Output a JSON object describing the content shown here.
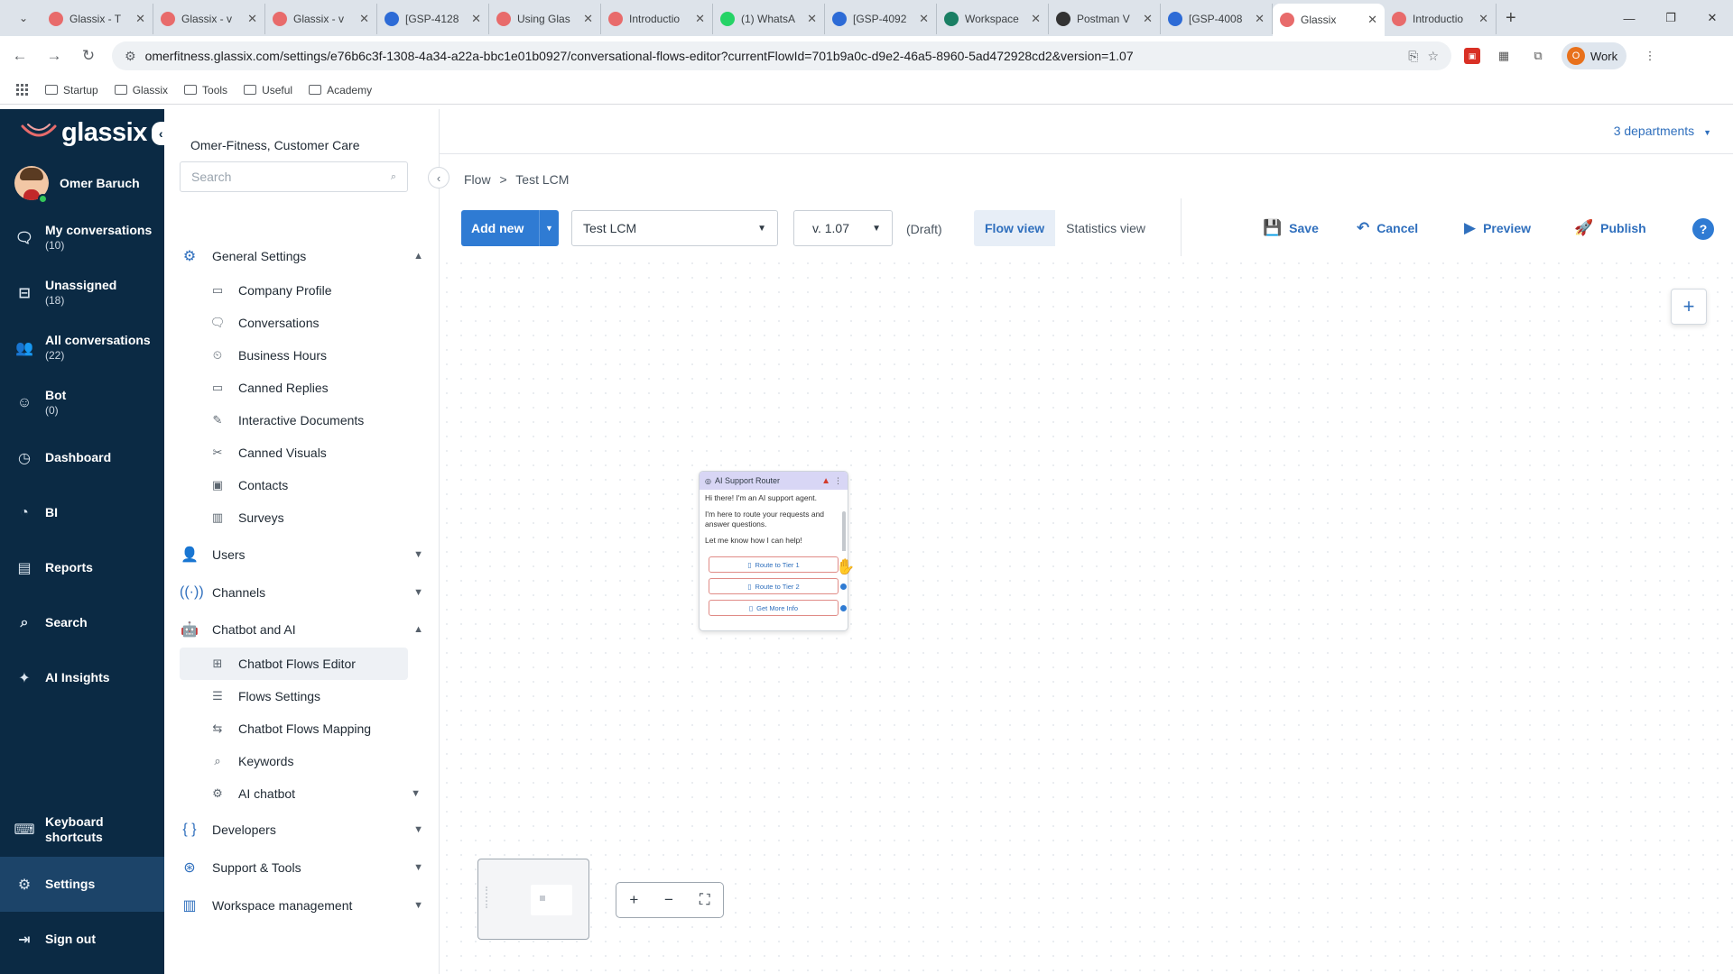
{
  "browser": {
    "tabs": [
      {
        "title": "Glassix - T",
        "fav": "glassix-icon",
        "color": "#e86b6b"
      },
      {
        "title": "Glassix - v",
        "fav": "glassix-icon",
        "color": "#e86b6b"
      },
      {
        "title": "Glassix - v",
        "fav": "glassix-icon",
        "color": "#e86b6b"
      },
      {
        "title": "[GSP-4128",
        "fav": "jira-icon",
        "color": "#2d6bd6"
      },
      {
        "title": "Using Glas",
        "fav": "glassix-icon",
        "color": "#e86b6b"
      },
      {
        "title": "Introductio",
        "fav": "glassix-icon",
        "color": "#e86b6b"
      },
      {
        "title": "(1) WhatsA",
        "fav": "whatsapp-icon",
        "color": "#25d366"
      },
      {
        "title": "[GSP-4092",
        "fav": "jira-icon",
        "color": "#2d6bd6"
      },
      {
        "title": "Workspace",
        "fav": "chatgpt-icon",
        "color": "#1a7f64"
      },
      {
        "title": "Postman V",
        "fav": "postman-icon",
        "color": "#333333"
      },
      {
        "title": "[GSP-4008",
        "fav": "jira-icon",
        "color": "#2d6bd6"
      },
      {
        "title": "Glassix",
        "fav": "glassix-icon",
        "color": "#e86b6b",
        "active": true
      },
      {
        "title": "Introductio",
        "fav": "glassix-icon",
        "color": "#e86b6b"
      }
    ],
    "url": "omerfitness.glassix.com/settings/e76b6c3f-1308-4a34-a22a-bbc1e01b0927/conversational-flows-editor?currentFlowId=701b9a0c-d9e2-46a5-8960-5ad472928cd2&version=1.07",
    "profile_initial": "O",
    "profile_label": "Work",
    "bookmarks": [
      "Startup",
      "Glassix",
      "Tools",
      "Useful",
      "Academy"
    ]
  },
  "app": {
    "logo_text": "glassix",
    "user_name": "Omer Baruch",
    "nav": [
      {
        "label": "My conversations",
        "count": "(10)",
        "icon": "chat-bubbles-icon"
      },
      {
        "label": "Unassigned",
        "count": "(18)",
        "icon": "inbox-icon"
      },
      {
        "label": "All conversations",
        "count": "(22)",
        "icon": "team-icon"
      },
      {
        "label": "Bot",
        "count": "(0)",
        "icon": "bot-icon"
      },
      {
        "label": "Dashboard",
        "count": "",
        "icon": "dashboard-icon"
      },
      {
        "label": "BI",
        "count": "",
        "icon": "pie-chart-icon"
      },
      {
        "label": "Reports",
        "count": "",
        "icon": "report-icon"
      },
      {
        "label": "Search",
        "count": "",
        "icon": "search-icon"
      },
      {
        "label": "AI Insights",
        "count": "",
        "icon": "sparkle-icon"
      }
    ],
    "nav_bottom": [
      {
        "label": "Keyboard shortcuts",
        "icon": "keyboard-icon"
      },
      {
        "label": "Settings",
        "icon": "gear-icon"
      },
      {
        "label": "Sign out",
        "icon": "sign-out-icon"
      }
    ],
    "departments_label": "3 departments"
  },
  "settings": {
    "department": "Omer-Fitness, Customer Care",
    "search_placeholder": "Search",
    "general": {
      "label": "General Settings",
      "items": [
        "Company Profile",
        "Conversations",
        "Business Hours",
        "Canned Replies",
        "Interactive Documents",
        "Canned Visuals",
        "Contacts",
        "Surveys"
      ]
    },
    "users": "Users",
    "channels": "Channels",
    "chatbot": {
      "label": "Chatbot and AI",
      "items": [
        "Chatbot Flows Editor",
        "Flows Settings",
        "Chatbot Flows Mapping",
        "Keywords",
        "AI chatbot"
      ]
    },
    "developers": "Developers",
    "support": "Support & Tools",
    "workspace": "Workspace management"
  },
  "editor": {
    "breadcrumb_root": "Flow",
    "breadcrumb_sep": ">",
    "breadcrumb_current": "Test LCM",
    "add_new": "Add new",
    "flow_name": "Test LCM",
    "version": "v. 1.07",
    "status": "(Draft)",
    "flow_view": "Flow view",
    "stats_view": "Statistics view",
    "save": "Save",
    "cancel": "Cancel",
    "preview": "Preview",
    "publish": "Publish",
    "help": "?"
  },
  "node": {
    "title": "AI Support Router",
    "lines": [
      "Hi there! I'm an AI support agent.",
      "I'm here to route your requests and answer questions.",
      "Let me know how I can help!"
    ],
    "buttons": [
      "Route to Tier 1",
      "Route to Tier 2",
      "Get More Info"
    ]
  }
}
